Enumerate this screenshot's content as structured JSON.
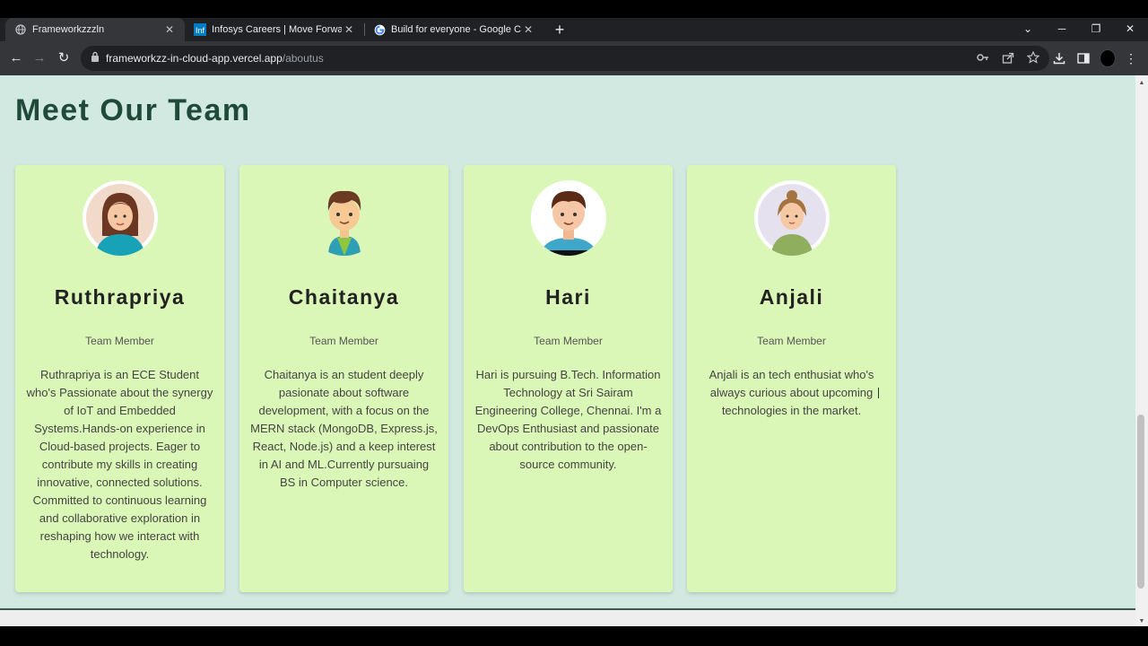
{
  "browser": {
    "tabs": [
      {
        "title": "Frameworkzzzln",
        "active": true
      },
      {
        "title": "Infosys Careers | Move Forward. T",
        "active": false
      },
      {
        "title": "Build for everyone - Google Care",
        "active": false
      }
    ],
    "url_host": "frameworkzz-in-cloud-app.vercel.app",
    "url_path": "/aboutus"
  },
  "page": {
    "heading": "Meet Our Team",
    "members": [
      {
        "name": "Ruthrapriya",
        "role": "Team Member",
        "bio": "Ruthrapriya is an ECE Student who's Passionate about the synergy of IoT and Embedded Systems.Hands-on experience in Cloud-based projects. Eager to contribute my skills in creating innovative, connected solutions. Committed to continuous learning and collaborative exploration in reshaping how we interact with technology."
      },
      {
        "name": "Chaitanya",
        "role": "Team Member",
        "bio": "Chaitanya is an student deeply pasionate about software development, with a focus on the MERN stack (MongoDB, Express.js, React, Node.js) and a keep interest in AI and ML.Currently pursuaing BS in Computer science."
      },
      {
        "name": "Hari",
        "role": "Team Member",
        "bio": "Hari is pursuing B.Tech. Information Technology at Sri Sairam Engineering College, Chennai. I'm a DevOps Enthusiast and passionate about contribution to the open-source community."
      },
      {
        "name": "Anjali",
        "role": "Team Member",
        "bio": "Anjali is an tech enthusiat who's always curious about upcoming technologies in the market."
      }
    ]
  },
  "colors": {
    "page_bg": "#d2e9e1",
    "card_bg": "#dbf7b7",
    "heading": "#1f4a3a"
  }
}
